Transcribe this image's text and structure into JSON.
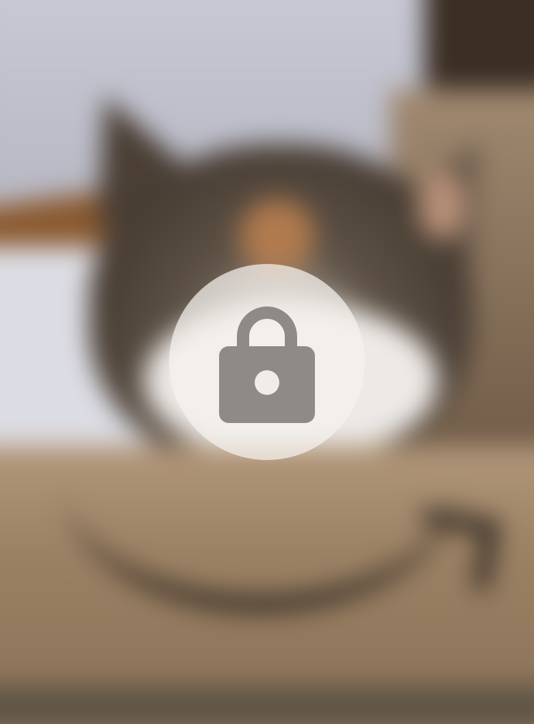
{
  "viewer": {
    "state": "locked",
    "image_blurred": true
  },
  "overlay": {
    "icon": "lock-icon",
    "badge_color": "#f5f2ee",
    "icon_color": "#8f8a86"
  }
}
